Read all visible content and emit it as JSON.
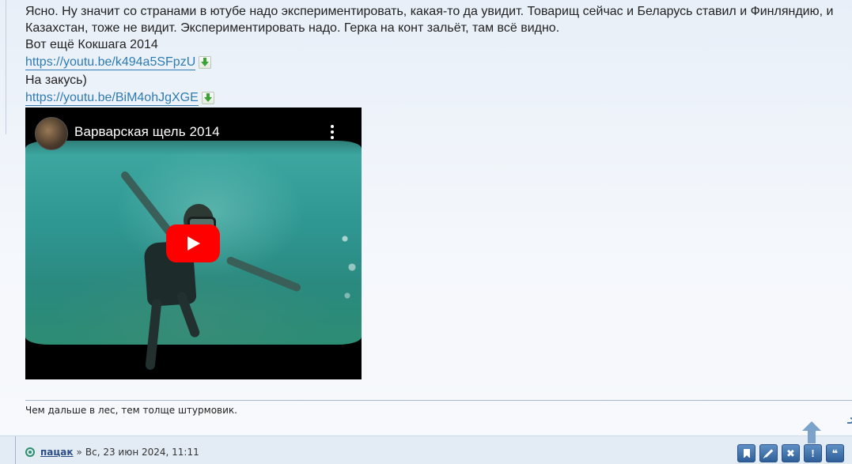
{
  "post": {
    "text_line1": "Ясно. Ну значит со странами в ютубе надо экспериментировать, какая-то да увидит. Товарищ сейчас и Беларусь ставил и Финляндию, и",
    "text_line2": "Казахстан, тоже не видит. Экспериментировать надо. Герка на конт зальёт, там всё видно.",
    "text_line3": "Вот ещё Кокшага 2014",
    "link1": "https://youtu.be/k494a5SFpzU",
    "text_line4": "На закусь)",
    "link2": "https://youtu.be/BiM4ohJgXGE"
  },
  "video": {
    "title": "Варварская щель 2014",
    "play_icon": "youtube-play-icon",
    "menu_icon": "kebab-menu-icon"
  },
  "signature": "Чем дальше в лес, тем толще штурмовик.",
  "footer": {
    "author": "пацак",
    "separator": "»",
    "date": "Вс, 23 июн 2024, 11:11",
    "buttons": [
      {
        "name": "bookmark-button",
        "icon": "bookmark-icon"
      },
      {
        "name": "edit-button",
        "icon": "pencil-icon",
        "color": "#3a6aa3"
      },
      {
        "name": "delete-button",
        "icon": "close-icon",
        "label": "✖"
      },
      {
        "name": "report-button",
        "icon": "exclamation-icon",
        "label": "!"
      },
      {
        "name": "quote-button",
        "icon": "quote-icon",
        "label": "❝"
      }
    ]
  },
  "colors": {
    "link": "#2e7bb4",
    "author": "#2b4e86",
    "button": "#3a6aa3",
    "youtube_red": "#ff0000"
  }
}
